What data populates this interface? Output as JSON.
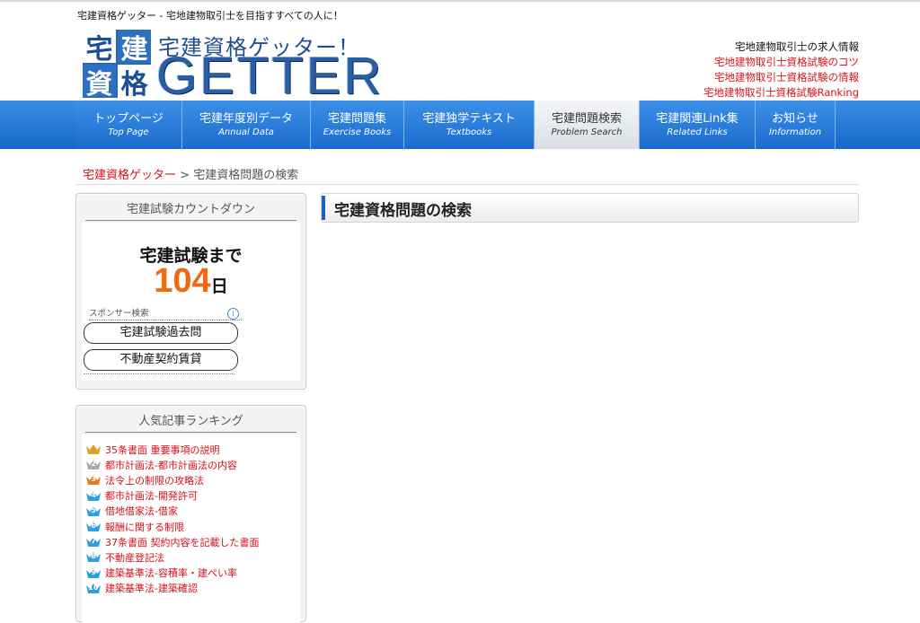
{
  "site": {
    "tagline": "宅建資格ゲッター - 宅地建物取引士を目指すすべての人に！",
    "logo_chars": [
      "宅",
      "建",
      "資",
      "格"
    ],
    "logo_subtitle": "宅建資格ゲッター！",
    "logo_main": "GETTER"
  },
  "header_links": [
    {
      "label": "宅地建物取引士の求人情報",
      "color": "#111111"
    },
    {
      "label": "宅地建物取引士資格試験のコツ",
      "color": "#d8101a"
    },
    {
      "label": "宅地建物取引士資格試験の情報",
      "color": "#d8101a"
    },
    {
      "label": "宅地建物取引士資格試験Ranking",
      "color": "#d8101a"
    }
  ],
  "nav": [
    {
      "jp": "トップページ",
      "en": "Top Page",
      "active": false
    },
    {
      "jp": "宅建年度別データ",
      "en": "Annual Data",
      "active": false
    },
    {
      "jp": "宅建問題集",
      "en": "Exercise Books",
      "active": false
    },
    {
      "jp": "宅建独学テキスト",
      "en": "Textbooks",
      "active": false
    },
    {
      "jp": "宅建問題検索",
      "en": "Problem Search",
      "active": true
    },
    {
      "jp": "宅建関連Link集",
      "en": "Related Links",
      "active": false
    },
    {
      "jp": "お知らせ",
      "en": "Information",
      "active": false
    }
  ],
  "breadcrumb": {
    "home": "宅建資格ゲッター",
    "sep": ">",
    "current": "宅建資格問題の検索"
  },
  "countdown": {
    "title": "宅建試験カウントダウン",
    "label": "宅建試験まで",
    "days": "104",
    "unit": "日",
    "sponsor_label": "スポンサー検索",
    "info_icon": "i",
    "sponsor_links": [
      "宅建試験過去問",
      "不動産契約賃貸"
    ]
  },
  "ranking": {
    "title": "人気記事ランキング",
    "items": [
      {
        "rank": "1",
        "label": "35条書面 重要事項の説明",
        "medal": "gold"
      },
      {
        "rank": "2",
        "label": "都市計画法-都市計画法の内容",
        "medal": "silver"
      },
      {
        "rank": "3",
        "label": "法令上の制限の攻略法",
        "medal": "bronze"
      },
      {
        "rank": "4",
        "label": "都市計画法-開発許可",
        "medal": "blue"
      },
      {
        "rank": "5",
        "label": "借地借家法-借家",
        "medal": "blue"
      },
      {
        "rank": "6",
        "label": "報酬に関する制限",
        "medal": "blue"
      },
      {
        "rank": "7",
        "label": "37条書面 契約内容を記載した書面",
        "medal": "blue"
      },
      {
        "rank": "8",
        "label": "不動産登記法",
        "medal": "blue"
      },
      {
        "rank": "9",
        "label": "建築基準法-容積率・建ぺい率",
        "medal": "blue"
      },
      {
        "rank": "10",
        "label": "建築基準法-建築確認",
        "medal": "blue"
      }
    ]
  },
  "main": {
    "title": "宅建資格問題の検索"
  },
  "colors": {
    "accent_red": "#d8101a",
    "nav_blue": "#1b6bcc",
    "countdown_orange": "#f26a0f",
    "medal_gold": "#d9a521",
    "medal_silver": "#a9a9a9",
    "medal_bronze": "#e07b1c",
    "medal_blue": "#2e9fe0"
  }
}
